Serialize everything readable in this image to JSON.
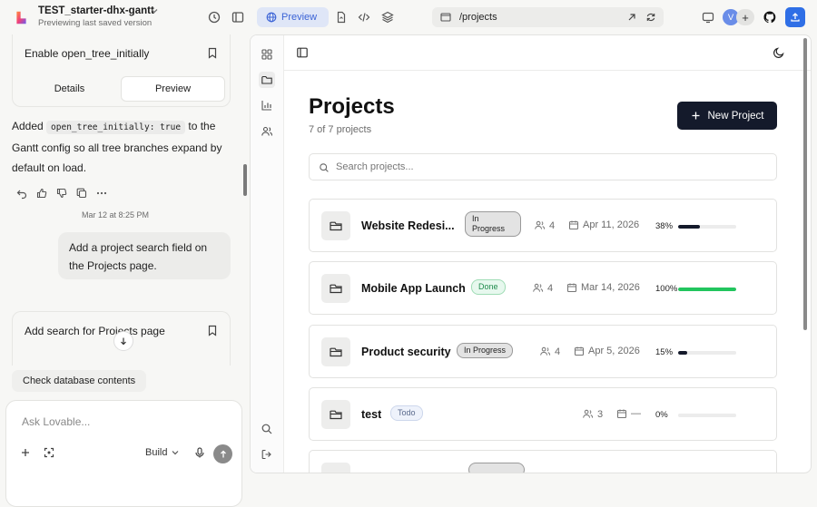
{
  "topbar": {
    "project_name": "TEST_starter-dhx-gantt",
    "project_status": "Previewing last saved version",
    "preview_label": "Preview",
    "url": "/projects",
    "avatar_initial": "V",
    "avatar_add": "+"
  },
  "chat": {
    "card1": {
      "title": "Enable open_tree_initially",
      "tabs": [
        "Details",
        "Preview"
      ],
      "active_tab": "Preview"
    },
    "message": {
      "prefix": "Added ",
      "code": "open_tree_initially: true",
      "suffix": " to the Gantt config so all tree branches expand by default on load."
    },
    "timestamp": "Mar 12 at 8:25 PM",
    "user_bubble": "Add a project search field on the Projects page.",
    "card2": {
      "title": "Add search for Projects page"
    },
    "suggestion_chip": "Check database contents",
    "composer": {
      "placeholder": "Ask Lovable...",
      "mode": "Build"
    }
  },
  "app": {
    "title": "Projects",
    "count_text": "7 of 7 projects",
    "new_button": "New Project",
    "search_placeholder": "Search projects...",
    "projects": [
      {
        "name": "Website Redesi...",
        "status": "In Progress",
        "status_kind": "prog",
        "members": "4",
        "date": "Apr 11, 2026",
        "percent_text": "38%",
        "progress": 0.38
      },
      {
        "name": "Mobile App Launch",
        "status": "Done",
        "status_kind": "done",
        "members": "4",
        "date": "Mar 14, 2026",
        "percent_text": "100%",
        "progress": 1.0
      },
      {
        "name": "Product security",
        "status": "In Progress",
        "status_kind": "prog",
        "members": "4",
        "date": "Apr 5, 2026",
        "percent_text": "15%",
        "progress": 0.15
      },
      {
        "name": "test",
        "status": "Todo",
        "status_kind": "todo",
        "members": "3",
        "date": "—",
        "percent_text": "0%",
        "progress": 0.0
      }
    ],
    "colors": {
      "progress_dark": "#141a2b",
      "progress_done": "#22c55e",
      "accent": "#2f6fe6"
    }
  }
}
